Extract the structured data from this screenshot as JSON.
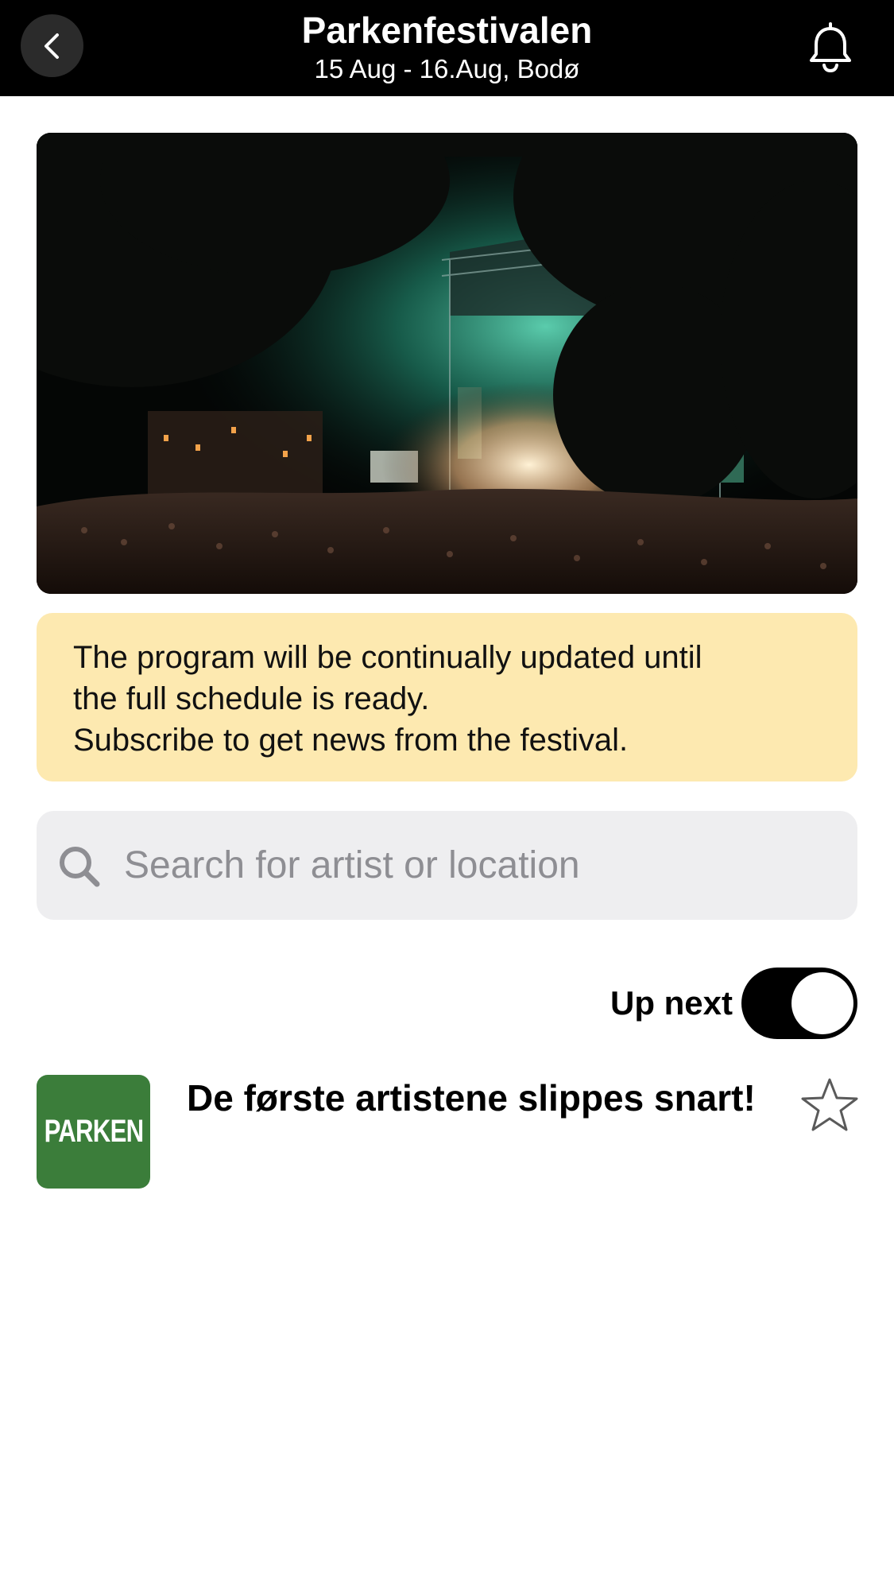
{
  "header": {
    "title": "Parkenfestivalen",
    "subtitle": "15 Aug - 16.Aug, Bodø",
    "back_icon": "chevron-left-icon",
    "bell_icon": "bell-icon",
    "background_color": "#000000"
  },
  "notice": {
    "lines": [
      "The program will be continually updated until",
      "the full schedule is ready.",
      "Subscribe to get news from the festival."
    ],
    "background_color": "#fde9b0"
  },
  "search": {
    "placeholder": "Search for artist or location",
    "value": "",
    "icon": "search-icon"
  },
  "up_next": {
    "label": "Up next",
    "toggle_on": true
  },
  "items": [
    {
      "logo_text": "PARKEN",
      "logo_color": "#3b7d3a",
      "title": "De første artistene slippes snart!",
      "favorite_icon": "star-outline-icon",
      "favorited": false
    }
  ]
}
